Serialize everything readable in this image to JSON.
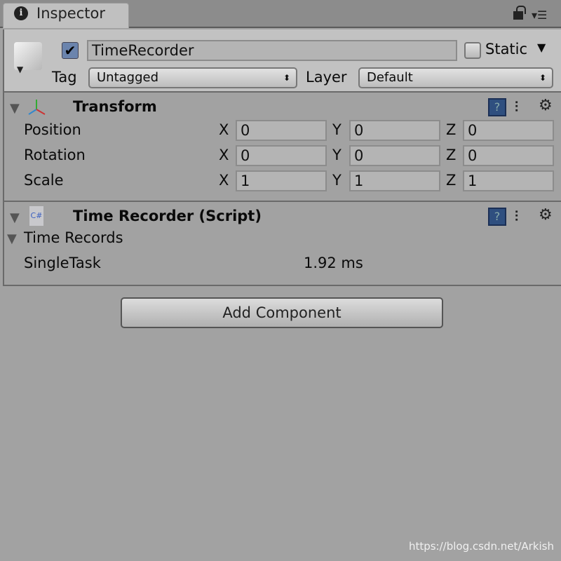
{
  "tab": {
    "title": "Inspector"
  },
  "object": {
    "active": true,
    "name": "TimeRecorder",
    "static_label": "Static",
    "static": false,
    "tag_label": "Tag",
    "tag": "Untagged",
    "layer_label": "Layer",
    "layer": "Default"
  },
  "transform": {
    "title": "Transform",
    "rows": [
      {
        "label": "Position",
        "x": "0",
        "y": "0",
        "z": "0"
      },
      {
        "label": "Rotation",
        "x": "0",
        "y": "0",
        "z": "0"
      },
      {
        "label": "Scale",
        "x": "1",
        "y": "1",
        "z": "1"
      }
    ],
    "axes": {
      "x": "X",
      "y": "Y",
      "z": "Z"
    }
  },
  "script": {
    "title": "Time Recorder (Script)",
    "icon_text": "C#",
    "foldout": "Time Records",
    "record_label": "SingleTask",
    "record_value": "1.92 ms"
  },
  "add_component": "Add Component",
  "watermark": "https://blog.csdn.net/Arkish"
}
